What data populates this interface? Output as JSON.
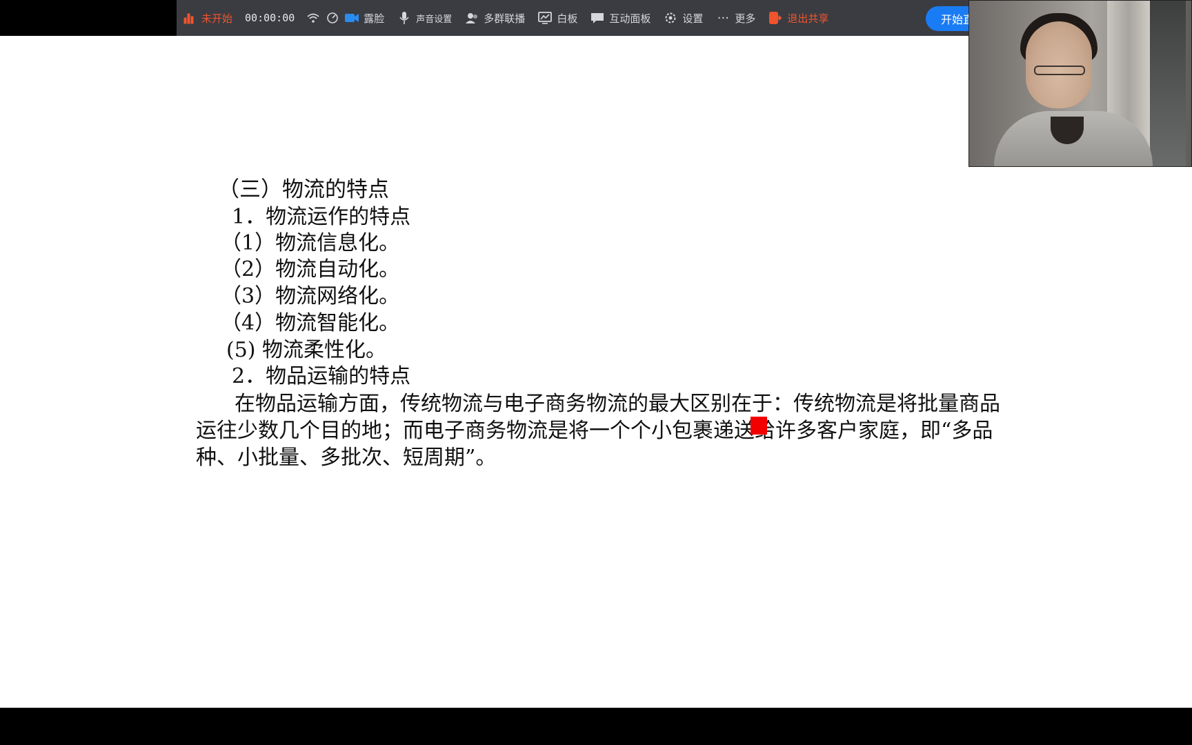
{
  "toolbar": {
    "status_label": "未开始",
    "timer": "00:00:00",
    "items": {
      "beauty": "露脸",
      "sound_settings": "声音设置",
      "multi_link": "多群联播",
      "whiteboard": "白板",
      "interactive_panel": "互动面板",
      "settings": "设置",
      "more": "更多",
      "exit_share": "退出共享"
    },
    "start_button": "开始直播",
    "colors": {
      "bg": "#3a3c42",
      "alert": "#f0542d",
      "primary": "#1a7cf4"
    }
  },
  "slide": {
    "section_title": "（三）物流的特点",
    "sub1": "1．物流运作的特点",
    "items": [
      "（1）物流信息化。",
      "（2）物流自动化。",
      "（3）物流网络化。",
      "（4）物流智能化。",
      "(5)  物流柔性化。"
    ],
    "sub2": "2．物品运输的特点",
    "paragraph": "在物品运输方面，传统物流与电子商务物流的最大区别在于：传统物流是将批量商品运往少数几个目的地；而电子商务物流是将一个个小包裹递送给许多客户家庭，即“多品种、小批量、多批次、短周期”。"
  }
}
